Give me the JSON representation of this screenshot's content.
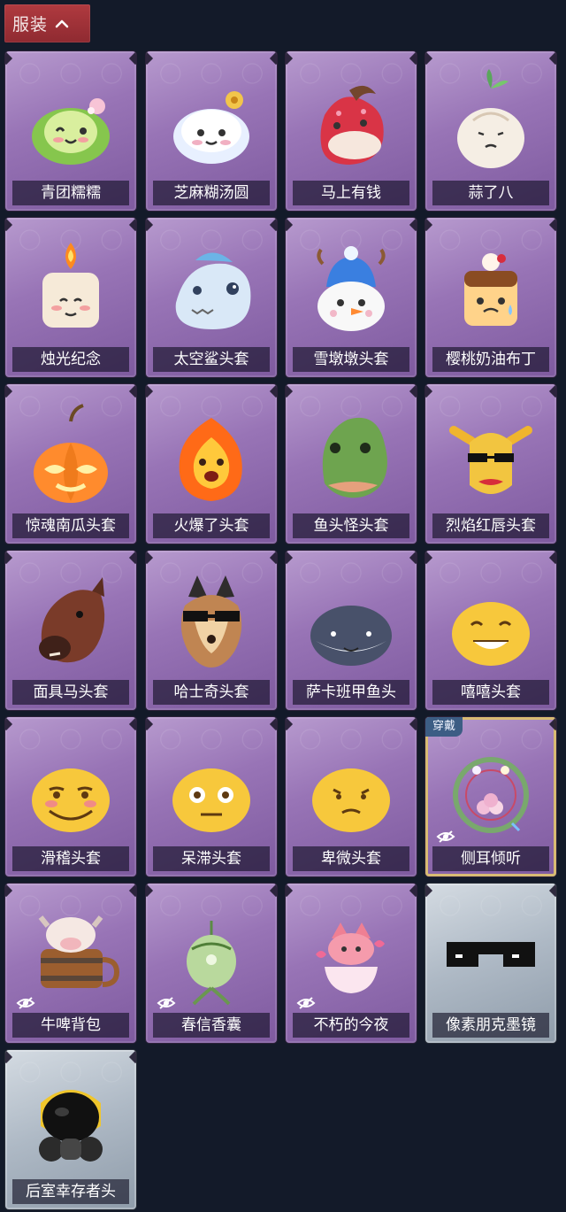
{
  "header": {
    "label": "服装",
    "chevron_icon": "chevron-up-icon"
  },
  "items": [
    {
      "label": "青团糯糯",
      "icon": "green-dumpling-icon",
      "badge": "",
      "hidden": false
    },
    {
      "label": "芝麻糊汤圆",
      "icon": "sesame-dumpling-icon",
      "badge": "",
      "hidden": false
    },
    {
      "label": "马上有钱",
      "icon": "horse-icon",
      "badge": "",
      "hidden": false
    },
    {
      "label": "蒜了八",
      "icon": "garlic-icon",
      "badge": "",
      "hidden": false
    },
    {
      "label": "烛光纪念",
      "icon": "candle-icon",
      "badge": "",
      "hidden": false
    },
    {
      "label": "太空鲨头套",
      "icon": "shark-icon",
      "badge": "",
      "hidden": false
    },
    {
      "label": "雪墩墩头套",
      "icon": "snowman-icon",
      "badge": "",
      "hidden": false
    },
    {
      "label": "樱桃奶油布丁",
      "icon": "pudding-icon",
      "badge": "",
      "hidden": false
    },
    {
      "label": "惊魂南瓜头套",
      "icon": "pumpkin-icon",
      "badge": "",
      "hidden": false
    },
    {
      "label": "火爆了头套",
      "icon": "flame-icon",
      "badge": "",
      "hidden": false
    },
    {
      "label": "鱼头怪头套",
      "icon": "fish-head-icon",
      "badge": "",
      "hidden": false
    },
    {
      "label": "烈焰红唇头套",
      "icon": "red-lips-icon",
      "badge": "",
      "hidden": false
    },
    {
      "label": "面具马头套",
      "icon": "horse-mask-icon",
      "badge": "",
      "hidden": false
    },
    {
      "label": "哈士奇头套",
      "icon": "husky-icon",
      "badge": "",
      "hidden": false
    },
    {
      "label": "萨卡班甲鱼头",
      "icon": "fish-icon",
      "badge": "",
      "hidden": false
    },
    {
      "label": "嘻嘻头套",
      "icon": "grin-emoji-icon",
      "badge": "",
      "hidden": false
    },
    {
      "label": "滑稽头套",
      "icon": "funny-emoji-icon",
      "badge": "",
      "hidden": false
    },
    {
      "label": "呆滞头套",
      "icon": "dazed-emoji-icon",
      "badge": "",
      "hidden": false
    },
    {
      "label": "卑微头套",
      "icon": "humble-emoji-icon",
      "badge": "",
      "hidden": false
    },
    {
      "label": "侧耳倾听",
      "icon": "flower-wreath-icon",
      "badge": "穿戴",
      "hidden": true
    },
    {
      "label": "牛啤背包",
      "icon": "cow-barrel-icon",
      "badge": "",
      "hidden": true
    },
    {
      "label": "春信香囊",
      "icon": "sachet-icon",
      "badge": "",
      "hidden": true
    },
    {
      "label": "不朽的今夜",
      "icon": "fox-cup-icon",
      "badge": "",
      "hidden": true
    },
    {
      "label": "像素朋克墨镜",
      "icon": "pixel-sunglasses-icon",
      "badge": "",
      "hidden": false
    },
    {
      "label": "后室幸存者头",
      "icon": "gas-mask-icon",
      "badge": "",
      "hidden": false
    }
  ]
}
